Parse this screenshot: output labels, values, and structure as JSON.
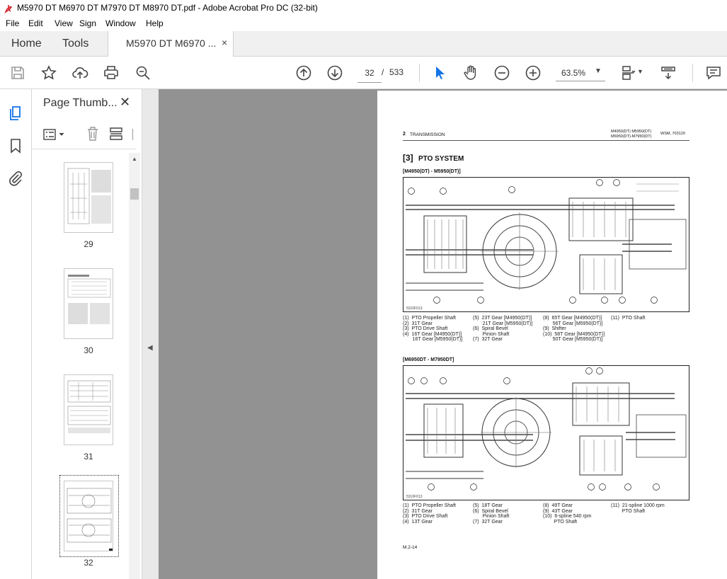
{
  "window": {
    "title": "M5970 DT M6970 DT M7970 DT M8970 DT.pdf - Adobe Acrobat Pro DC (32-bit)"
  },
  "menu": [
    "File",
    "Edit",
    "View",
    "Sign",
    "Window",
    "Help"
  ],
  "tabs": {
    "home": "Home",
    "tools": "Tools",
    "document": "M5970 DT M6970 ...",
    "close": "×"
  },
  "toolbar": {
    "page_current": "32",
    "page_sep": "/",
    "page_total": "533",
    "zoom": "63.5%"
  },
  "thumbnails": {
    "panel_title": "Page Thumb...",
    "close": "✕",
    "pages": [
      {
        "number": "29"
      },
      {
        "number": "30"
      },
      {
        "number": "31"
      },
      {
        "number": "32",
        "selected": true
      }
    ]
  },
  "page": {
    "header_left_num": "2",
    "header_left": "TRANSMISSION",
    "header_models_1": "M4950(DT) M5950(DT)",
    "header_models_2": "M6950(DT)-M7950(DT)",
    "header_ref": "WSM, 703120",
    "section_num": "[3]",
    "section_title": "PTO SYSTEM",
    "fig1": {
      "label": "[M4950(DT) - M5950(DT)]",
      "code": "5310F013",
      "legend": [
        "(1)  PTO Propeller Shaft\n(2)  31T Gear\n(3)  PTO Drive Shaft\n(4)  16T Gear [M4950(DT)]\n       16T Gear [M5950(DT)]",
        "(5)  23T Gear [M4950(DT)]\n       21T Gear [M5950(DT)]\n(6)  Spiral Bevel\n       Pinion Shaft\n(7)  32T Gear",
        "(8)  65T Gear [M4950(DT)]\n       56T Gear [M5950(DT)]\n(9)  Shifter\n(10)  58T Gear [M4950(DT)]\n       50T Gear [M5950(DT)]",
        "(11)  PTO Shaft"
      ]
    },
    "fig2": {
      "label": "[M6950DT - M7950DT]",
      "code": "5310F013",
      "legend": [
        "(1)  PTO Propeller Shaft\n(2)  31T Gear\n(3)  PTO Drive Shaft\n(4)  13T Gear",
        "(5)  18T Gear\n(6)  Spiral Bevel\n       Pinion Shaft\n(7)  32T Gear",
        "(8)  49T Gear\n(9)  43T Gear\n(10)  6-spline 540 rpm\n        PTO Shaft",
        "(11)  21-spline 1000 rpm\n        PTO Shaft"
      ]
    },
    "footer": "M.2-14"
  },
  "colors": {
    "acrobat_red": "#d4242b",
    "accent_blue": "#1473e6",
    "viewer_bg": "#929292"
  }
}
